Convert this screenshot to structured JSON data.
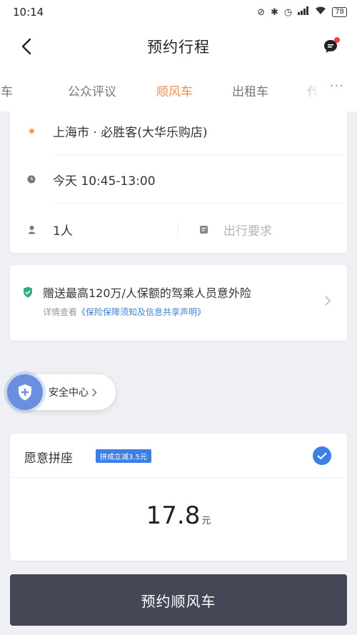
{
  "status_bar": {
    "time": "10:14",
    "battery": "78"
  },
  "header": {
    "title": "预约行程"
  },
  "tabs": [
    {
      "label": "专车",
      "active": false
    },
    {
      "label": "公众评议",
      "active": false
    },
    {
      "label": "顺风车",
      "active": true
    },
    {
      "label": "出租车",
      "active": false
    },
    {
      "label": "代驾",
      "active": false
    }
  ],
  "trip": {
    "destination": "上海市 · 必胜客(大华乐购店)",
    "time": "今天 10:45-13:00",
    "passengers": "1人",
    "requirements_placeholder": "出行要求"
  },
  "insurance": {
    "main": "赠送最高120万/人保额的驾乘人员意外险",
    "sub_prefix": "详情查看",
    "sub_link": "《保险保障须知及信息共享声明》"
  },
  "safety": {
    "label": "安全中心"
  },
  "carpool": {
    "label": "愿意拼座",
    "badge": "拼成立减3.5元",
    "checked": true,
    "price": "17.8",
    "unit": "元"
  },
  "book_button": {
    "label": "预约顺风车"
  },
  "colors": {
    "accent_orange": "#f08e4f",
    "accent_blue": "#3d7fe5",
    "button_dark": "#454656"
  }
}
